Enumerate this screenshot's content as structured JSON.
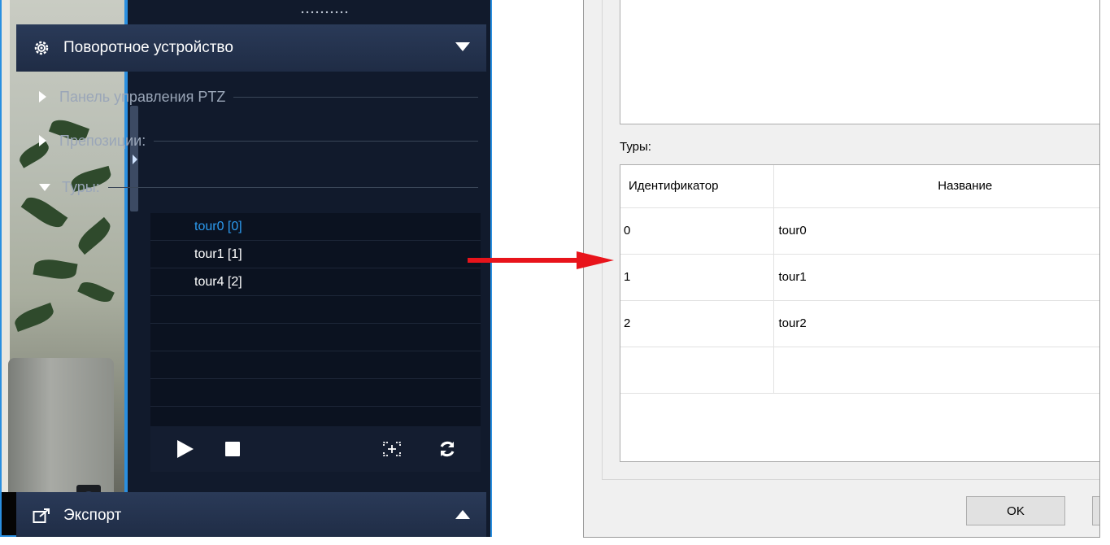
{
  "ptz_panel": {
    "section_title": "Поворотное устройство",
    "sub_items": [
      {
        "label": "Панель управления PTZ",
        "expanded": false
      },
      {
        "label": "Препозиции:",
        "expanded": false
      },
      {
        "label": "Туры:",
        "expanded": true
      }
    ],
    "tours": [
      {
        "label": "tour0 [0]",
        "active": true
      },
      {
        "label": "tour1 [1]",
        "active": false
      },
      {
        "label": "tour4 [2]",
        "active": false
      }
    ],
    "controls": [
      "play-icon",
      "stop-icon",
      "record-tour-icon",
      "refresh-icon"
    ]
  },
  "export_section": {
    "title": "Экспорт"
  },
  "dialog": {
    "tours_label": "Туры:",
    "columns": [
      "Идентификатор",
      "Название"
    ],
    "rows": [
      {
        "id": "0",
        "name": "tour0"
      },
      {
        "id": "1",
        "name": "tour1"
      },
      {
        "id": "2",
        "name": "tour2"
      }
    ],
    "ok_label": "OK"
  },
  "colors": {
    "panel_bg": "#111a2c",
    "active_tour": "#2c9bf0",
    "accent_border": "#2a8fe0",
    "arrow": "#e8141b"
  }
}
